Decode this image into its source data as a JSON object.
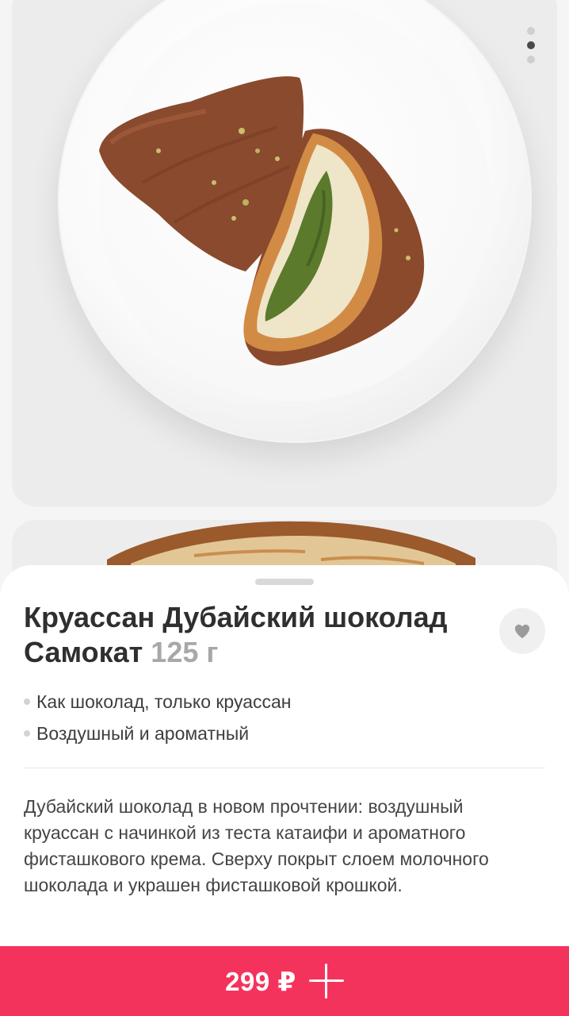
{
  "product": {
    "name": "Круассан Дубайский шоколад Самокат",
    "weight": "125 г",
    "features": [
      {
        "text": "Как шоколад, только круассан"
      },
      {
        "text": "Воздушный и ароматный"
      }
    ],
    "description": "Дубайский шоколад в новом прочтении: воздушный круассан с начинкой из теста катаифи и ароматного фисташкового крема. Сверху покрыт слоем молочного шоколада и украшен фисташковой крошкой.",
    "price": "299 ₽"
  },
  "gallery": {
    "photo_count": 3,
    "active_index": 1
  },
  "icons": {
    "favorite": "heart-icon",
    "add": "plus-icon"
  },
  "colors": {
    "accent": "#f4335c",
    "weight_text": "#a8a8a8"
  }
}
